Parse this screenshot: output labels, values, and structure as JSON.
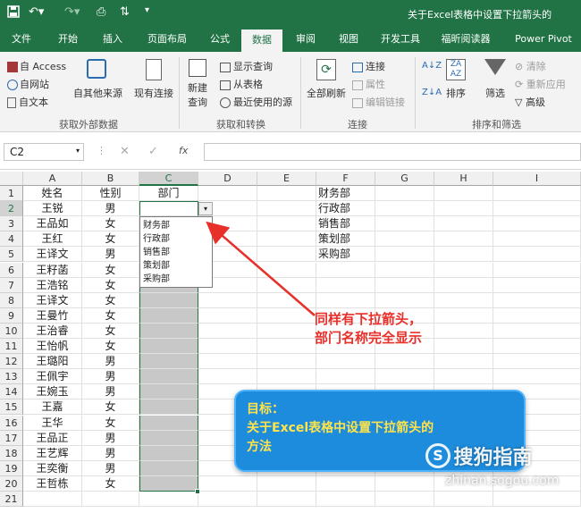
{
  "titlebar": {
    "title": "关于Excel表格中设置下拉箭头的"
  },
  "tabs": [
    "文件",
    "开始",
    "插入",
    "页面布局",
    "公式",
    "数据",
    "审阅",
    "视图",
    "开发工具",
    "福昕阅读器",
    "Power Pivot"
  ],
  "ribbon": {
    "ext": {
      "access": "自 Access",
      "web": "自网站",
      "text": "自文本",
      "other": "自其他来源",
      "existing": "现有连接",
      "group": "获取外部数据"
    },
    "transform": {
      "newquery": "新建",
      "newquery2": "查询",
      "show": "显示查询",
      "table": "从表格",
      "recent": "最近使用的源",
      "group": "获取和转换"
    },
    "conn": {
      "refresh": "全部刷新",
      "connections": "连接",
      "props": "属性",
      "editlinks": "编辑链接",
      "group": "连接"
    },
    "sort": {
      "sort": "排序",
      "filter": "筛选",
      "clear": "清除",
      "reapply": "重新应用",
      "advanced": "高级",
      "group": "排序和筛选"
    }
  },
  "formula": {
    "cell": "C2",
    "fx": "fx"
  },
  "columns": [
    "A",
    "B",
    "C",
    "D",
    "E",
    "F",
    "G",
    "H",
    "I"
  ],
  "rows": [
    "1",
    "2",
    "3",
    "4",
    "5",
    "6",
    "7",
    "8",
    "9",
    "10",
    "11",
    "12",
    "13",
    "14",
    "15",
    "16",
    "17",
    "18",
    "19",
    "20",
    "21"
  ],
  "colA": [
    "姓名",
    "王锐",
    "王品如",
    "王红",
    "王译文",
    "王籽菡",
    "王浩铭",
    "王译文",
    "王曼竹",
    "王治睿",
    "王怡帆",
    "王璐阳",
    "王佩宇",
    "王婉玉",
    "王嘉",
    "王华",
    "王品正",
    "王艺辉",
    "王奕衡",
    "王哲栋"
  ],
  "colB": [
    "性别",
    "男",
    "女",
    "女",
    "男",
    "女",
    "女",
    "女",
    "女",
    "女",
    "女",
    "男",
    "男",
    "男",
    "女",
    "女",
    "男",
    "男",
    "男",
    "女"
  ],
  "colC": [
    "部门"
  ],
  "colF": [
    "财务部",
    "行政部",
    "销售部",
    "策划部",
    "采购部"
  ],
  "dropdown": [
    "财务部",
    "行政部",
    "销售部",
    "策划部",
    "采购部"
  ],
  "annotation": {
    "line1": "同样有下拉箭头，",
    "line2": "部门名称完全显示"
  },
  "box": {
    "line1": "目标：",
    "line2": "关于Excel表格中设置下拉箭头的",
    "line3": "方法"
  },
  "watermark": {
    "brand": "搜狗指南",
    "url": "zhinan.sogou.com",
    "logo": "S"
  }
}
